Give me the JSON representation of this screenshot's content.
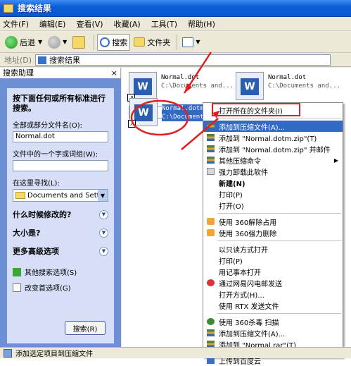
{
  "window": {
    "title": "搜索结果"
  },
  "menu": [
    "文件(F)",
    "编辑(E)",
    "查看(V)",
    "收藏(A)",
    "工具(T)",
    "帮助(H)"
  ],
  "toolbar": {
    "back": "后退",
    "search": "搜索",
    "folders": "文件夹"
  },
  "address": {
    "label": "地址(D)",
    "value": "搜索结果"
  },
  "search_pane": {
    "title": "搜索助理",
    "close": "×",
    "description": "按下面任何或所有标准进行搜索。",
    "filename_label": "全部或部分文件名(O):",
    "filename_value": "Normal.dot",
    "word_label": "文件中的一个字或词组(W):",
    "word_value": "",
    "lookin_label": "在这里寻找(L):",
    "lookin_value": "Documents and Settings",
    "sections": [
      "什么时候修改的?",
      "大小是?",
      "更多高级选项"
    ],
    "links": [
      "其他搜索选项(S)",
      "改变首选项(G)"
    ],
    "search_button": "搜索(R)"
  },
  "files": [
    {
      "name": "Normal.dot",
      "path": "C:\\Documents and..."
    },
    {
      "name": "Normal.dot",
      "path": "C:\\Documents and..."
    },
    {
      "name": "Normal.dotm",
      "path": "C:\\Documents..."
    }
  ],
  "context_menu": {
    "items": [
      {
        "label": "打开所在的文件夹(I)",
        "icon": "none"
      },
      {
        "sep": true
      },
      {
        "label": "添加到压缩文件(A)...",
        "icon": "zip-icon",
        "highlight": true
      },
      {
        "label": "添加到 \"Normal.dotm.zip\"(T)",
        "icon": "zip-icon"
      },
      {
        "label": "添加到 \"Normal.dotm.zip\" 并邮件",
        "icon": "zip-icon"
      },
      {
        "label": "其他压缩命令",
        "icon": "zip-icon",
        "submenu": true
      },
      {
        "label": "强力卸载此软件",
        "icon": "uninstall-icon"
      },
      {
        "label": "新建(N)",
        "icon": "none",
        "bold": true
      },
      {
        "label": "打印(P)",
        "icon": "none"
      },
      {
        "label": "打开(O)",
        "icon": "none"
      },
      {
        "sep": true
      },
      {
        "label": "使用 360解除占用",
        "icon": "unlock-icon"
      },
      {
        "label": "使用 360强力删除",
        "icon": "shred-icon"
      },
      {
        "sep": true
      },
      {
        "label": "以只读方式打开",
        "icon": "none"
      },
      {
        "label": "打印(P)",
        "icon": "none"
      },
      {
        "label": "用记事本打开",
        "icon": "none"
      },
      {
        "label": "通过网易闪电邮发送",
        "icon": "netease-icon"
      },
      {
        "label": "打开方式(H)...",
        "icon": "none"
      },
      {
        "label": "使用 RTX 发送文件",
        "icon": "none"
      },
      {
        "sep": true
      },
      {
        "label": "使用 360杀毒 扫描",
        "icon": "shield-icon"
      },
      {
        "label": "添加到压缩文件(A)...",
        "icon": "rar-icon"
      },
      {
        "label": "添加到 \"Normal.rar\"(T)",
        "icon": "rar-icon"
      },
      {
        "sep": true
      },
      {
        "label": "上传到百度云",
        "icon": "cloud-icon"
      }
    ]
  },
  "status": {
    "text": "添加选定项目到压缩文件"
  }
}
